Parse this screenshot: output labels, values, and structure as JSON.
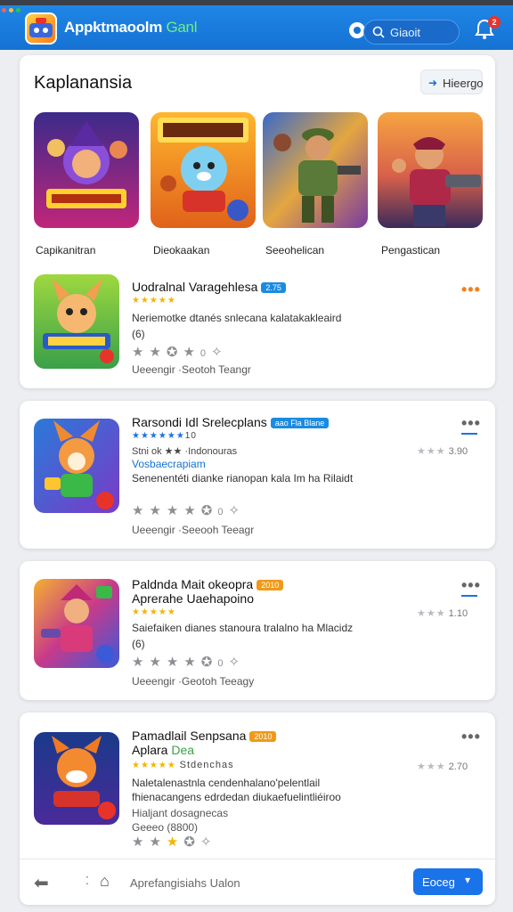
{
  "topbar": {
    "title_main": "Appktmaoolm",
    "title_accent": "Ganl",
    "search_placeholder": "Giaoit",
    "notification_count": "2"
  },
  "featured": {
    "title": "Kaplanansia",
    "header_button": "Hieergo",
    "tiles": [
      {
        "label": "Capikanitran",
        "icon": "game-art-wizard"
      },
      {
        "label": "Dieokaakan",
        "icon": "game-art-bear"
      },
      {
        "label": "Seeohelican",
        "icon": "game-art-soldier"
      },
      {
        "label": "Pengastican",
        "icon": "game-art-gunner"
      }
    ],
    "row": {
      "title": "Uodralnal Varagehlesa",
      "badge": "2.75",
      "stars": "★★★★★",
      "desc1": "Neriemotke dtanés snlecana kalatakakleaird",
      "desc2": "(6)",
      "rating_value": "0",
      "footer": "Ueeengir ·Seotoh Teangr"
    }
  },
  "apps": [
    {
      "title": "Rarsondi Idl Srelecplans",
      "badge": "aao Fla Blane",
      "stars": "★★★★★★",
      "stars_suffix": "10",
      "meta": "Stni ok ★★ ·Indonouras",
      "link": "Vosbaecrapiam",
      "desc": "Senenentéti dianke rianopan kala Im ha Rilaidt",
      "rating_value": "0",
      "footer": "Ueeengir ·Seeooh Teeagr",
      "side_value": "3.90",
      "icon": "app-icon-fox"
    },
    {
      "title": "Paldnda Mait okeopra",
      "title2": "Aprerahe Uaehapoino",
      "badge": "2010",
      "stars": "★★★★★",
      "desc": "Saiefaiken dianes stanoura tralalno ha Mlacidz",
      "desc2": "(6)",
      "rating_value": "0",
      "footer": "Ueeengir ·Geotoh Teeagy",
      "side_value": "1.10",
      "icon": "app-icon-hero"
    },
    {
      "title": "Pamadlail Senpsana",
      "title2": "Aplara",
      "title2_accent": "Dea",
      "badge": "2010",
      "stars": "★★★★★",
      "meta": "Stdenchas",
      "desc": "Naletalenastnla cendenhalano'pelentlail",
      "desc2": "fhienacangens edrdedan diukaefuelintliéiroo",
      "link_sub1": "Hialjant dosagnecas",
      "link_sub2": "Geeeo (8800)",
      "rating_value": "",
      "side_value": "2.70",
      "icon": "app-icon-cat"
    }
  ],
  "bottombar": {
    "text": "Aprefangisiahs Ualon",
    "button": "Eoceg"
  },
  "colors": {
    "topbar": "#1572d3",
    "accent": "#1a73e8",
    "star": "#f4b400",
    "badge_orange": "#f09a18"
  }
}
